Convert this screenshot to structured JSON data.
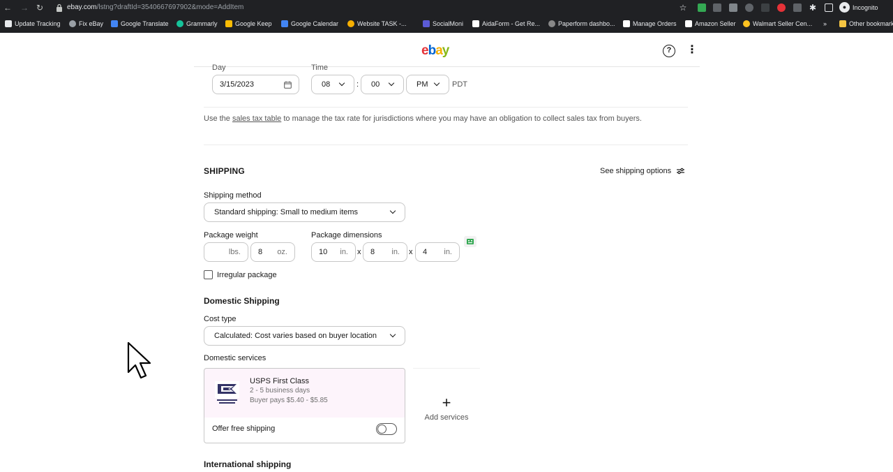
{
  "browser": {
    "url_host": "ebay.com",
    "url_path": "/lstng?draftId=3540667697902&mode=AddItem",
    "incognito_label": "Incognito",
    "bookmarks": [
      {
        "label": "Update Tracking",
        "color": "#e8eaed"
      },
      {
        "label": "Fix eBay",
        "color": "#9aa0a6"
      },
      {
        "label": "Google Translate",
        "color": "#4285f4"
      },
      {
        "label": "Grammarly",
        "color": "#15c39a"
      },
      {
        "label": "Google Keep",
        "color": "#fbbc04"
      },
      {
        "label": "Google Calendar",
        "color": "#4285f4"
      },
      {
        "label": "Website TASK -...",
        "color": "#f5af02"
      },
      {
        "label": "SocialMoni",
        "color": "#5b5bd6"
      },
      {
        "label": "AidaForm - Get Re...",
        "color": "#ffffff"
      },
      {
        "label": "Paperform dashbo...",
        "color": "#888888"
      },
      {
        "label": "Manage Orders",
        "color": "#ffffff"
      },
      {
        "label": "Amazon Seller",
        "color": "#ffffff"
      },
      {
        "label": "Walmart Seller Cen...",
        "color": "#ffc220"
      },
      {
        "label": "Other bookmarks",
        "color": "#f5c542"
      }
    ]
  },
  "header": {
    "logo_e": "e",
    "logo_b": "b",
    "logo_a": "a",
    "logo_y": "y",
    "help": "?",
    "more": "⋮"
  },
  "schedule": {
    "day_label": "Day",
    "time_label": "Time",
    "date_value": "3/15/2023",
    "hour": "08",
    "colon": ":",
    "minute": "00",
    "ampm": "PM",
    "tz": "PDT"
  },
  "tax": {
    "prefix": "Use the ",
    "link": "sales tax table",
    "suffix": " to manage the tax rate for jurisdictions where you may have an obligation to collect sales tax from buyers."
  },
  "shipping": {
    "title": "SHIPPING",
    "see_options": "See shipping options",
    "method_label": "Shipping method",
    "method_value": "Standard shipping: Small to medium items",
    "weight_label": "Package weight",
    "lbs_value": "",
    "lbs_unit": "lbs.",
    "oz_value": "8",
    "oz_unit": "oz.",
    "dims_label": "Package dimensions",
    "dim_l": "10",
    "dim_w": "8",
    "dim_h": "4",
    "dim_unit": "in.",
    "dim_sep": "x",
    "irregular_label": "Irregular package",
    "irregular_checked": false
  },
  "domestic": {
    "title": "Domestic Shipping",
    "cost_type_label": "Cost type",
    "cost_type_value": "Calculated: Cost varies based on buyer location",
    "services_label": "Domestic services",
    "service": {
      "name": "USPS First Class",
      "days": "2 - 5 business days",
      "price": "Buyer pays $5.40 - $5.85",
      "logo_text": "UNITED STATES POSTAL SERVICE"
    },
    "offer_free_label": "Offer free shipping",
    "offer_free_on": false,
    "add_services_label": "Add services",
    "add_icon": "+"
  },
  "international": {
    "title": "International shipping"
  }
}
